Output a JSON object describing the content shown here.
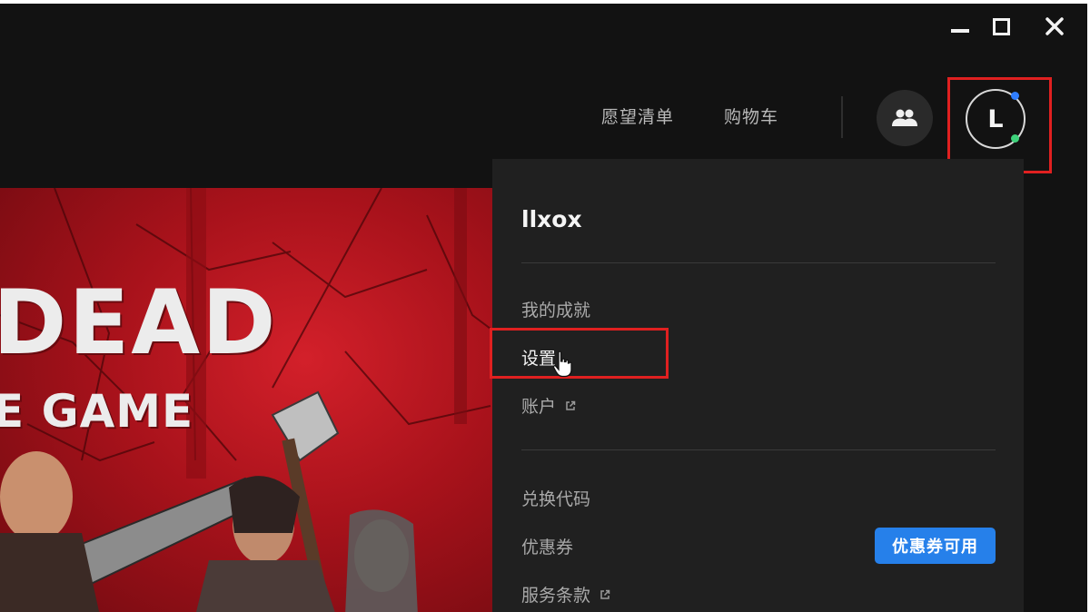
{
  "window": {
    "minimize_icon": "minimize-icon",
    "maximize_icon": "maximize-icon",
    "close_icon": "close-icon"
  },
  "nav": {
    "wishlist": "愿望清单",
    "cart": "购物车",
    "friends_icon": "friends-icon"
  },
  "profile": {
    "avatar_letter": "L",
    "status_colors": {
      "top": "#2f7dff",
      "bottom": "#3dd17a"
    }
  },
  "hero": {
    "title": "DEAD",
    "subtitle": "E GAME"
  },
  "menu": {
    "username": "llxox",
    "items": [
      {
        "label": "我的成就"
      },
      {
        "label": "设置"
      },
      {
        "label": "账户"
      },
      {
        "label": "兑换代码"
      },
      {
        "label": "优惠券"
      },
      {
        "label": "服务条款"
      }
    ],
    "coupon_badge": "优惠券可用"
  },
  "colors": {
    "highlight": "#e02020",
    "accent": "#2680ea",
    "menu_bg": "#202020",
    "app_bg": "#121212"
  }
}
